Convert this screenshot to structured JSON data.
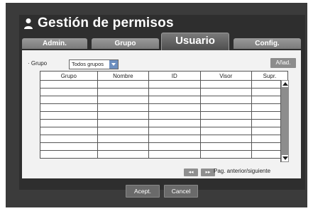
{
  "dialog": {
    "title": "Gestión de permisos",
    "tabs": [
      {
        "label": "Admin."
      },
      {
        "label": "Grupo"
      },
      {
        "label": "Usuario",
        "active": true
      },
      {
        "label": "Config."
      }
    ]
  },
  "filter": {
    "group_label": "· Grupo",
    "group_value": "Todos grupos",
    "add_button": "Añad."
  },
  "table": {
    "columns": [
      "Grupo",
      "Nombre",
      "ID",
      "Visor",
      "Supr."
    ],
    "empty_rows": 8
  },
  "pager": {
    "prev_label": "◂◂",
    "next_label": "▸▸",
    "text": "Pag. anterior/siguiente"
  },
  "footer": {
    "accept_label": "Acept.",
    "cancel_label": "Cancel"
  },
  "icons": {
    "title": "user-icon",
    "dropdown": "chevron-down-icon",
    "scroll_up": "arrow-up-icon",
    "scroll_down": "arrow-down-icon"
  }
}
